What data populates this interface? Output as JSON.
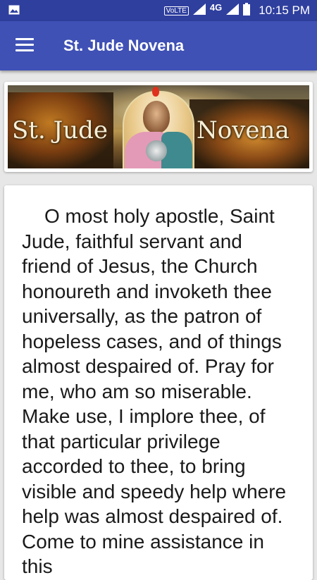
{
  "status_bar": {
    "volte": "VoLTE",
    "network": "4G",
    "time": "10:15 PM",
    "icons": [
      "image-icon",
      "signal-icon",
      "battery-icon"
    ]
  },
  "app_bar": {
    "title": "St. Jude Novena",
    "menu_icon": "hamburger-menu-icon",
    "color": "#3f51b5"
  },
  "banner": {
    "text_left": "St. Jude",
    "text_right": "Novena"
  },
  "prayer": {
    "text": "O most holy apostle, Saint Jude, faithful servant and friend of Jesus, the Church honoureth and invoketh thee universally, as the patron of hopeless cases, and of things almost despaired of. Pray for me, who am so miserable. Make use, I implore thee, of that particular privilege accorded to thee, to bring visible and speedy help where help was almost despaired of. Come to mine assistance in this"
  }
}
